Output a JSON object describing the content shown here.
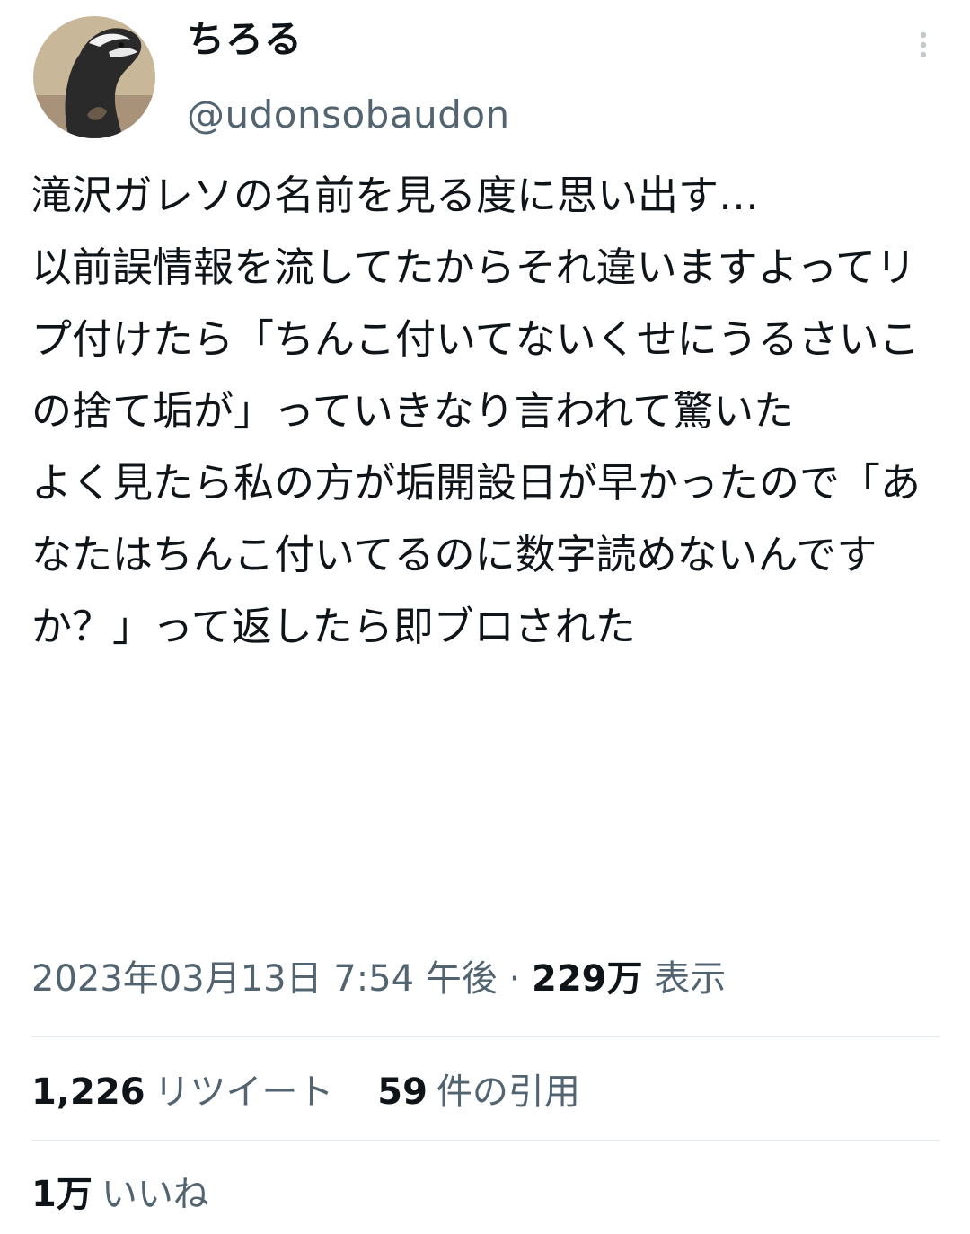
{
  "user": {
    "display_name": "ちろる",
    "handle": "@udonsobaudon",
    "avatar_icon": "penguin-avatar"
  },
  "more_icon": "more-vertical-icon",
  "tweet": {
    "text": "滝沢ガレソの名前を見る度に思い出す…\n以前誤情報を流してたからそれ違いますよってリプ付けたら「ちんこ付いてないくせにうるさいこの捨て垢が」っていきなり言われて驚いた\nよく見たら私の方が垢開設日が早かったので「あなたはちんこ付いてるのに数字読めないんですか？」って返したら即ブロされた"
  },
  "meta": {
    "timestamp": "2023年03月13日 7:54 午後",
    "separator": "·",
    "views_count": "229万",
    "views_label": "表示"
  },
  "stats": {
    "retweets_count": "1,226",
    "retweets_label": "リツイート",
    "quotes_count": "59",
    "quotes_label": "件の引用",
    "likes_count": "1万",
    "likes_label": "いいね"
  },
  "colors": {
    "text_primary": "#0f1419",
    "text_secondary": "#536471",
    "divider": "#e6e9eb"
  }
}
